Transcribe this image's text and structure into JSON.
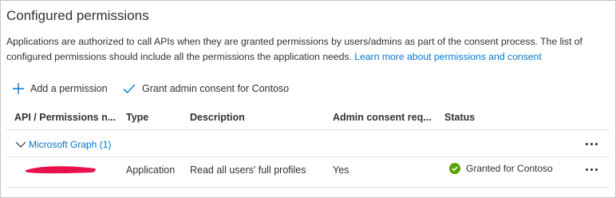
{
  "panel": {
    "title": "Configured permissions",
    "description": "Applications are authorized to call APIs when they are granted permissions by users/admins as part of the consent process. The list of configured permissions should include all the permissions the application needs.",
    "learn_more": "Learn more about permissions and consent"
  },
  "toolbar": {
    "add_permission": "Add a permission",
    "grant_consent": "Grant admin consent for Contoso"
  },
  "table": {
    "headers": [
      "API / Permissions n...",
      "Type",
      "Description",
      "Admin consent req...",
      "Status"
    ],
    "group": {
      "label": "Microsoft Graph (1)"
    },
    "rows": [
      {
        "name_redacted": true,
        "type": "Application",
        "description": "Read all users' full profiles",
        "admin_consent": "Yes",
        "status": "Granted for Contoso"
      }
    ]
  },
  "colors": {
    "accent": "#0078d4",
    "success": "#57a300",
    "redaction": "#e8114a"
  },
  "icons": [
    "plus-icon",
    "checkmark-icon",
    "chevron-down-icon",
    "more-icon",
    "success-check-icon"
  ]
}
